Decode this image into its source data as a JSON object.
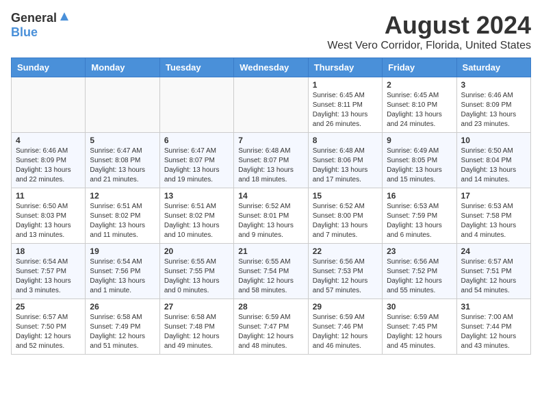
{
  "header": {
    "logo_general": "General",
    "logo_blue": "Blue",
    "title": "August 2024",
    "subtitle": "West Vero Corridor, Florida, United States"
  },
  "weekdays": [
    "Sunday",
    "Monday",
    "Tuesday",
    "Wednesday",
    "Thursday",
    "Friday",
    "Saturday"
  ],
  "weeks": [
    [
      {
        "day": "",
        "info": ""
      },
      {
        "day": "",
        "info": ""
      },
      {
        "day": "",
        "info": ""
      },
      {
        "day": "",
        "info": ""
      },
      {
        "day": "1",
        "info": "Sunrise: 6:45 AM\nSunset: 8:11 PM\nDaylight: 13 hours and 26 minutes."
      },
      {
        "day": "2",
        "info": "Sunrise: 6:45 AM\nSunset: 8:10 PM\nDaylight: 13 hours and 24 minutes."
      },
      {
        "day": "3",
        "info": "Sunrise: 6:46 AM\nSunset: 8:09 PM\nDaylight: 13 hours and 23 minutes."
      }
    ],
    [
      {
        "day": "4",
        "info": "Sunrise: 6:46 AM\nSunset: 8:09 PM\nDaylight: 13 hours and 22 minutes."
      },
      {
        "day": "5",
        "info": "Sunrise: 6:47 AM\nSunset: 8:08 PM\nDaylight: 13 hours and 21 minutes."
      },
      {
        "day": "6",
        "info": "Sunrise: 6:47 AM\nSunset: 8:07 PM\nDaylight: 13 hours and 19 minutes."
      },
      {
        "day": "7",
        "info": "Sunrise: 6:48 AM\nSunset: 8:07 PM\nDaylight: 13 hours and 18 minutes."
      },
      {
        "day": "8",
        "info": "Sunrise: 6:48 AM\nSunset: 8:06 PM\nDaylight: 13 hours and 17 minutes."
      },
      {
        "day": "9",
        "info": "Sunrise: 6:49 AM\nSunset: 8:05 PM\nDaylight: 13 hours and 15 minutes."
      },
      {
        "day": "10",
        "info": "Sunrise: 6:50 AM\nSunset: 8:04 PM\nDaylight: 13 hours and 14 minutes."
      }
    ],
    [
      {
        "day": "11",
        "info": "Sunrise: 6:50 AM\nSunset: 8:03 PM\nDaylight: 13 hours and 13 minutes."
      },
      {
        "day": "12",
        "info": "Sunrise: 6:51 AM\nSunset: 8:02 PM\nDaylight: 13 hours and 11 minutes."
      },
      {
        "day": "13",
        "info": "Sunrise: 6:51 AM\nSunset: 8:02 PM\nDaylight: 13 hours and 10 minutes."
      },
      {
        "day": "14",
        "info": "Sunrise: 6:52 AM\nSunset: 8:01 PM\nDaylight: 13 hours and 9 minutes."
      },
      {
        "day": "15",
        "info": "Sunrise: 6:52 AM\nSunset: 8:00 PM\nDaylight: 13 hours and 7 minutes."
      },
      {
        "day": "16",
        "info": "Sunrise: 6:53 AM\nSunset: 7:59 PM\nDaylight: 13 hours and 6 minutes."
      },
      {
        "day": "17",
        "info": "Sunrise: 6:53 AM\nSunset: 7:58 PM\nDaylight: 13 hours and 4 minutes."
      }
    ],
    [
      {
        "day": "18",
        "info": "Sunrise: 6:54 AM\nSunset: 7:57 PM\nDaylight: 13 hours and 3 minutes."
      },
      {
        "day": "19",
        "info": "Sunrise: 6:54 AM\nSunset: 7:56 PM\nDaylight: 13 hours and 1 minute."
      },
      {
        "day": "20",
        "info": "Sunrise: 6:55 AM\nSunset: 7:55 PM\nDaylight: 13 hours and 0 minutes."
      },
      {
        "day": "21",
        "info": "Sunrise: 6:55 AM\nSunset: 7:54 PM\nDaylight: 12 hours and 58 minutes."
      },
      {
        "day": "22",
        "info": "Sunrise: 6:56 AM\nSunset: 7:53 PM\nDaylight: 12 hours and 57 minutes."
      },
      {
        "day": "23",
        "info": "Sunrise: 6:56 AM\nSunset: 7:52 PM\nDaylight: 12 hours and 55 minutes."
      },
      {
        "day": "24",
        "info": "Sunrise: 6:57 AM\nSunset: 7:51 PM\nDaylight: 12 hours and 54 minutes."
      }
    ],
    [
      {
        "day": "25",
        "info": "Sunrise: 6:57 AM\nSunset: 7:50 PM\nDaylight: 12 hours and 52 minutes."
      },
      {
        "day": "26",
        "info": "Sunrise: 6:58 AM\nSunset: 7:49 PM\nDaylight: 12 hours and 51 minutes."
      },
      {
        "day": "27",
        "info": "Sunrise: 6:58 AM\nSunset: 7:48 PM\nDaylight: 12 hours and 49 minutes."
      },
      {
        "day": "28",
        "info": "Sunrise: 6:59 AM\nSunset: 7:47 PM\nDaylight: 12 hours and 48 minutes."
      },
      {
        "day": "29",
        "info": "Sunrise: 6:59 AM\nSunset: 7:46 PM\nDaylight: 12 hours and 46 minutes."
      },
      {
        "day": "30",
        "info": "Sunrise: 6:59 AM\nSunset: 7:45 PM\nDaylight: 12 hours and 45 minutes."
      },
      {
        "day": "31",
        "info": "Sunrise: 7:00 AM\nSunset: 7:44 PM\nDaylight: 12 hours and 43 minutes."
      }
    ]
  ]
}
